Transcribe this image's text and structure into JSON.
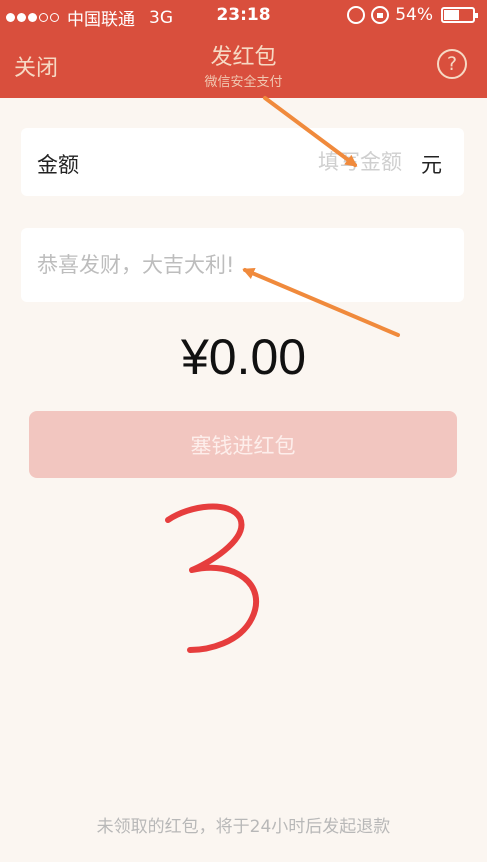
{
  "status_bar": {
    "carrier": "中国联通",
    "network": "3G",
    "time": "23:18",
    "battery": "54%",
    "battery_level": 0.54
  },
  "nav": {
    "close_label": "关闭",
    "title": "发红包",
    "subtitle": "微信安全支付",
    "help_label": "?"
  },
  "form": {
    "amount_label": "金额",
    "amount_placeholder": "填写金额",
    "amount_unit": "元",
    "message_placeholder": "恭喜发财，大吉大利!"
  },
  "total": "¥0.00",
  "submit_label": "塞钱进红包",
  "footer_note": "未领取的红包，将于24小时后发起退款",
  "annotation": {
    "handwritten_text": "3",
    "arrow_color": "#f08a3c",
    "handwriting_color": "#e63d3d"
  },
  "colors": {
    "header": "#d94f3d",
    "button_disabled": "#f2c6c0",
    "page_bg": "#fbf6f1"
  }
}
